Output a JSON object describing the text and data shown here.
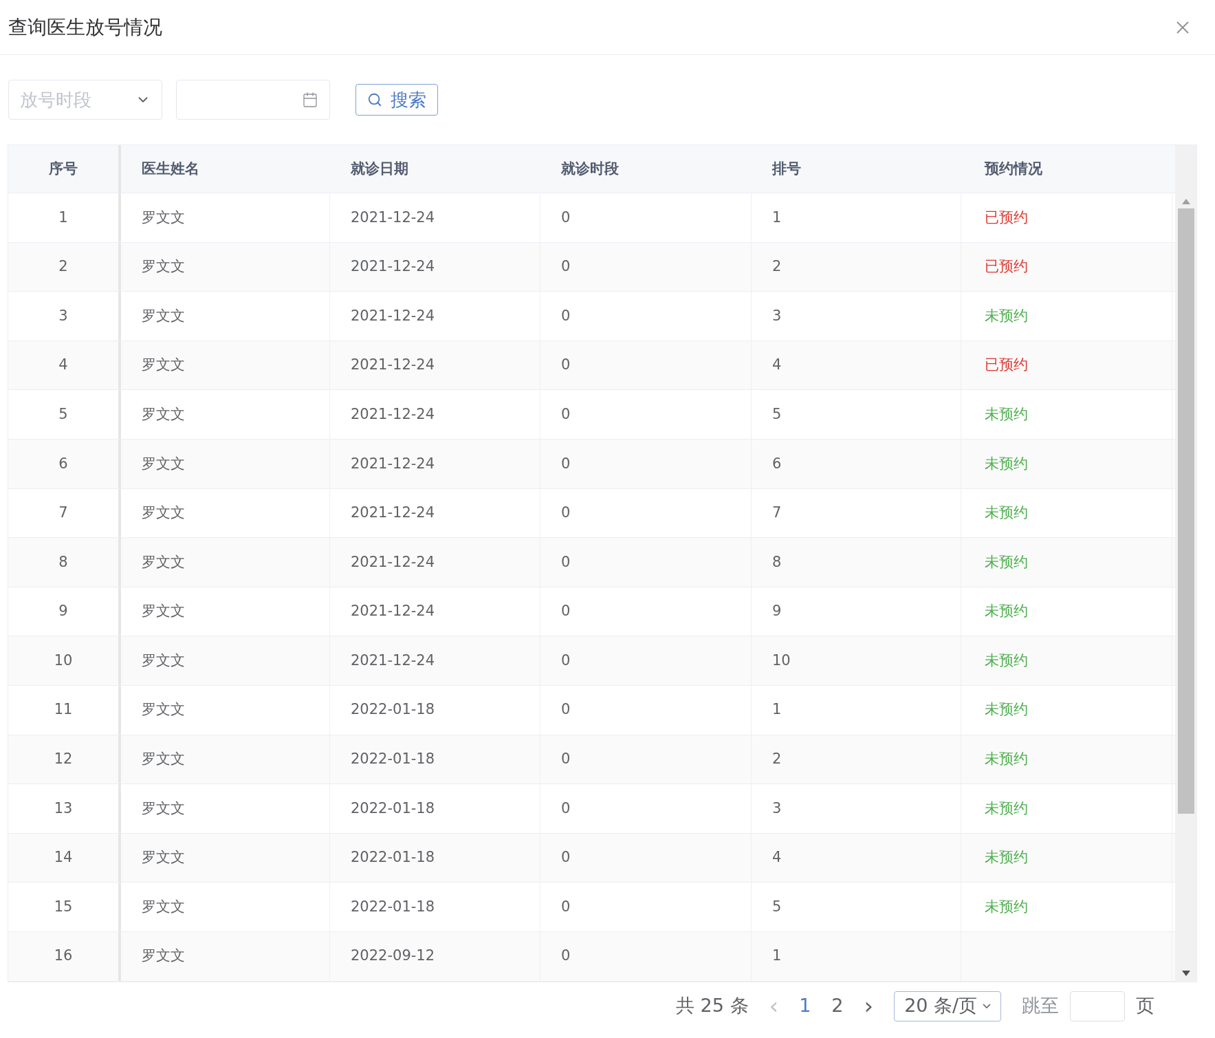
{
  "dialog": {
    "title": "查询医生放号情况"
  },
  "filters": {
    "period_select": {
      "placeholder": "放号时段"
    },
    "search_button": "搜索"
  },
  "table": {
    "columns": [
      "序号",
      "医生姓名",
      "就诊日期",
      "就诊时段",
      "排号",
      "预约情况"
    ],
    "rows": [
      {
        "index": "1",
        "doctor": "罗文文",
        "date": "2021-12-24",
        "period": "0",
        "number": "1",
        "status": "已预约",
        "booked": true
      },
      {
        "index": "2",
        "doctor": "罗文文",
        "date": "2021-12-24",
        "period": "0",
        "number": "2",
        "status": "已预约",
        "booked": true
      },
      {
        "index": "3",
        "doctor": "罗文文",
        "date": "2021-12-24",
        "period": "0",
        "number": "3",
        "status": "未预约",
        "booked": false
      },
      {
        "index": "4",
        "doctor": "罗文文",
        "date": "2021-12-24",
        "period": "0",
        "number": "4",
        "status": "已预约",
        "booked": true
      },
      {
        "index": "5",
        "doctor": "罗文文",
        "date": "2021-12-24",
        "period": "0",
        "number": "5",
        "status": "未预约",
        "booked": false
      },
      {
        "index": "6",
        "doctor": "罗文文",
        "date": "2021-12-24",
        "period": "0",
        "number": "6",
        "status": "未预约",
        "booked": false
      },
      {
        "index": "7",
        "doctor": "罗文文",
        "date": "2021-12-24",
        "period": "0",
        "number": "7",
        "status": "未预约",
        "booked": false
      },
      {
        "index": "8",
        "doctor": "罗文文",
        "date": "2021-12-24",
        "period": "0",
        "number": "8",
        "status": "未预约",
        "booked": false
      },
      {
        "index": "9",
        "doctor": "罗文文",
        "date": "2021-12-24",
        "period": "0",
        "number": "9",
        "status": "未预约",
        "booked": false
      },
      {
        "index": "10",
        "doctor": "罗文文",
        "date": "2021-12-24",
        "period": "0",
        "number": "10",
        "status": "未预约",
        "booked": false
      },
      {
        "index": "11",
        "doctor": "罗文文",
        "date": "2022-01-18",
        "period": "0",
        "number": "1",
        "status": "未预约",
        "booked": false
      },
      {
        "index": "12",
        "doctor": "罗文文",
        "date": "2022-01-18",
        "period": "0",
        "number": "2",
        "status": "未预约",
        "booked": false
      },
      {
        "index": "13",
        "doctor": "罗文文",
        "date": "2022-01-18",
        "period": "0",
        "number": "3",
        "status": "未预约",
        "booked": false
      },
      {
        "index": "14",
        "doctor": "罗文文",
        "date": "2022-01-18",
        "period": "0",
        "number": "4",
        "status": "未预约",
        "booked": false
      },
      {
        "index": "15",
        "doctor": "罗文文",
        "date": "2022-01-18",
        "period": "0",
        "number": "5",
        "status": "未预约",
        "booked": false
      },
      {
        "index": "16",
        "doctor": "罗文文",
        "date": "2022-09-12",
        "period": "0",
        "number": "1"
      }
    ]
  },
  "pagination": {
    "total": "共 25 条",
    "prev": "‹",
    "pages": [
      {
        "label": "1",
        "selected": true
      },
      {
        "label": "2",
        "selected": false
      }
    ],
    "next": "›",
    "page_size": "20 条/页",
    "jump_label": "跳至",
    "jump_suffix": "页"
  }
}
